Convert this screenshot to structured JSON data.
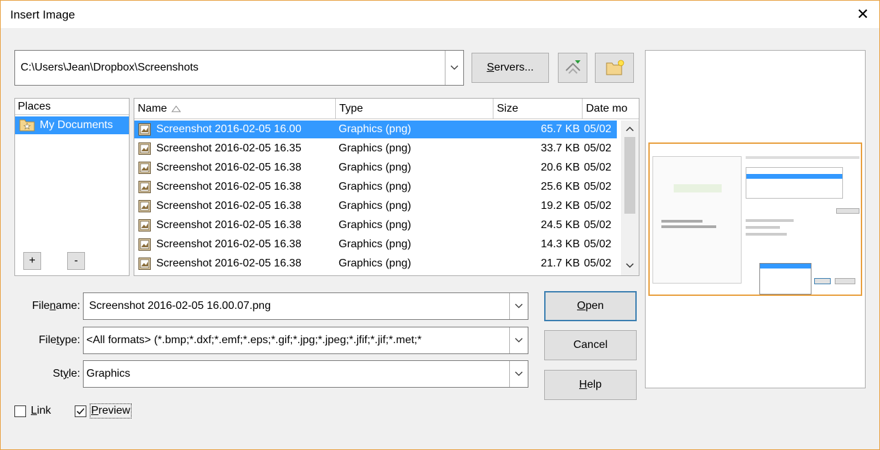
{
  "dialog": {
    "title": "Insert Image"
  },
  "path": {
    "value": "C:\\Users\\Jean\\Dropbox\\Screenshots"
  },
  "toolbar": {
    "servers_label": "Servers...",
    "servers_mnemonic": "S",
    "servers_rest": "ervers..."
  },
  "places": {
    "header": "Places",
    "items": [
      {
        "label": "My Documents"
      }
    ],
    "add_label": "+",
    "remove_label": "-"
  },
  "files": {
    "columns": {
      "name": "Name",
      "type": "Type",
      "size": "Size",
      "date": "Date mo"
    },
    "rows": [
      {
        "name": "Screenshot 2016-02-05 16.00",
        "type": "Graphics (png)",
        "size": "65.7 KB",
        "date": "05/02"
      },
      {
        "name": "Screenshot 2016-02-05 16.35",
        "type": "Graphics (png)",
        "size": "33.7 KB",
        "date": "05/02"
      },
      {
        "name": "Screenshot 2016-02-05 16.38",
        "type": "Graphics (png)",
        "size": "20.6 KB",
        "date": "05/02"
      },
      {
        "name": "Screenshot 2016-02-05 16.38",
        "type": "Graphics (png)",
        "size": "25.6 KB",
        "date": "05/02"
      },
      {
        "name": "Screenshot 2016-02-05 16.38",
        "type": "Graphics (png)",
        "size": "19.2 KB",
        "date": "05/02"
      },
      {
        "name": "Screenshot 2016-02-05 16.38",
        "type": "Graphics (png)",
        "size": "24.5 KB",
        "date": "05/02"
      },
      {
        "name": "Screenshot 2016-02-05 16.38",
        "type": "Graphics (png)",
        "size": "14.3 KB",
        "date": "05/02"
      },
      {
        "name": "Screenshot 2016-02-05 16.38",
        "type": "Graphics (png)",
        "size": "21.7 KB",
        "date": "05/02"
      }
    ]
  },
  "form": {
    "file_name": {
      "pre": "File ",
      "mn": "n",
      "post": "ame:",
      "value": "Screenshot 2016-02-05 16.00.07.png"
    },
    "file_type": {
      "pre": "File ",
      "mn": "t",
      "post": "ype:",
      "value": "<All formats> (*.bmp;*.dxf;*.emf;*.eps;*.gif;*.jpg;*.jpeg;*.jfif;*.jif;*.met;*"
    },
    "style": {
      "pre": "St",
      "mn": "y",
      "post": "le:",
      "value": "Graphics"
    }
  },
  "buttons": {
    "open": {
      "mn": "O",
      "rest": "pen"
    },
    "cancel": {
      "label": "Cancel"
    },
    "help": {
      "mn": "H",
      "rest": "elp"
    }
  },
  "options": {
    "link": {
      "mn": "L",
      "rest": "ink",
      "checked": false
    },
    "preview": {
      "mn": "P",
      "rest": "review",
      "checked": true
    }
  },
  "colors": {
    "selection": "#3399ff",
    "accent_border": "#e8a040",
    "default_button": "#3c7fb1"
  }
}
